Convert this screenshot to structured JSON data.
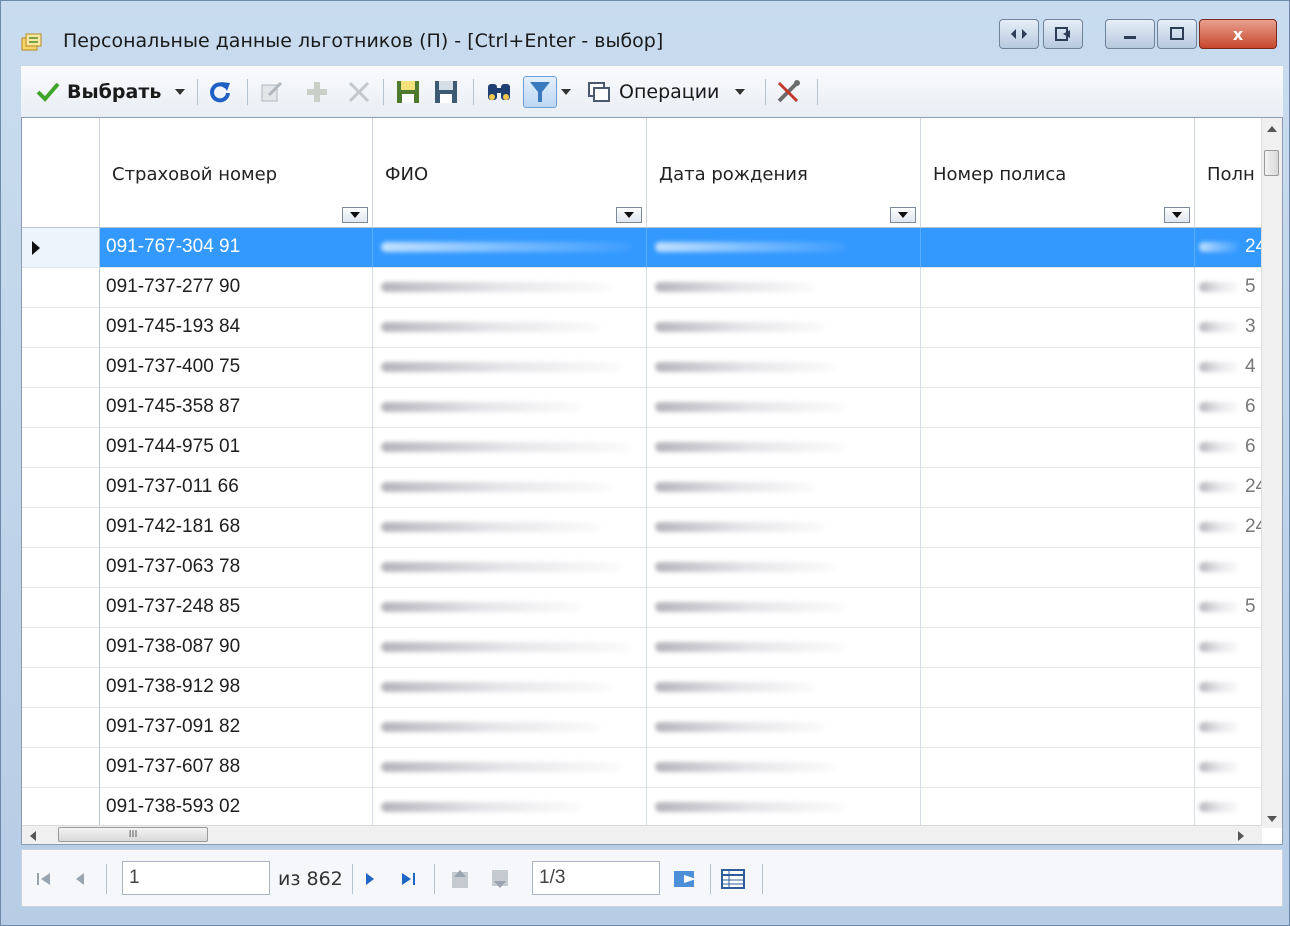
{
  "window": {
    "title": "Персональные данные льготников (П) - [Ctrl+Enter - выбор]",
    "close_label": "x"
  },
  "toolbar": {
    "select_label": "Выбрать",
    "operations_label": "Операции"
  },
  "grid": {
    "columns": [
      {
        "label": "Страховой номер"
      },
      {
        "label": "ФИО"
      },
      {
        "label": "Дата рождения"
      },
      {
        "label": "Номер полиса"
      },
      {
        "label": "Полн"
      }
    ],
    "rows": [
      {
        "snils": "091-767-304 91",
        "tail": "24",
        "selected": true
      },
      {
        "snils": "091-737-277 90",
        "tail": "5"
      },
      {
        "snils": "091-745-193 84",
        "tail": "3"
      },
      {
        "snils": "091-737-400 75",
        "tail": "4"
      },
      {
        "snils": "091-745-358 87",
        "tail": "6"
      },
      {
        "snils": "091-744-975 01",
        "tail": "6"
      },
      {
        "snils": "091-737-011 66",
        "tail": "24"
      },
      {
        "snils": "091-742-181 68",
        "tail": "24"
      },
      {
        "snils": "091-737-063 78",
        "tail": ""
      },
      {
        "snils": "091-737-248 85",
        "tail": "5"
      },
      {
        "snils": "091-738-087 90",
        "tail": ""
      },
      {
        "snils": "091-738-912 98",
        "tail": ""
      },
      {
        "snils": "091-737-091 82",
        "tail": ""
      },
      {
        "snils": "091-737-607 88",
        "tail": ""
      },
      {
        "snils": "091-738-593 02",
        "tail": ""
      }
    ],
    "hscroll_grip": "III"
  },
  "navigator": {
    "current_record": "1",
    "of_total": "из 862",
    "page": "1/3"
  },
  "colors": {
    "selection": "#3399ff",
    "title_bar": "#c9dcef"
  }
}
